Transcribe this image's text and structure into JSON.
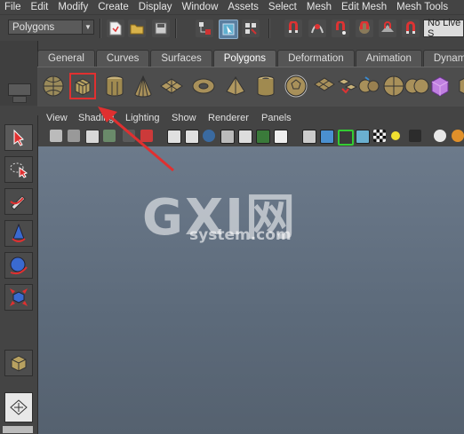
{
  "menu": [
    "File",
    "Edit",
    "Modify",
    "Create",
    "Display",
    "Window",
    "Assets",
    "Select",
    "Mesh",
    "Edit Mesh",
    "Mesh Tools"
  ],
  "status": {
    "mode": "Polygons",
    "no_live": "No Live S"
  },
  "shelf_tabs": [
    "General",
    "Curves",
    "Surfaces",
    "Polygons",
    "Deformation",
    "Animation",
    "Dynam"
  ],
  "active_tab": "Polygons",
  "panel_menu": [
    "View",
    "Shading",
    "Lighting",
    "Show",
    "Renderer",
    "Panels"
  ],
  "watermark": {
    "brand": "GXI网",
    "domain": "system.com"
  },
  "colors": {
    "highlight": "#e03030",
    "viewport_top": "#6c7a8b",
    "viewport_bottom": "#55616f",
    "accent_cube": "#c080e0"
  }
}
